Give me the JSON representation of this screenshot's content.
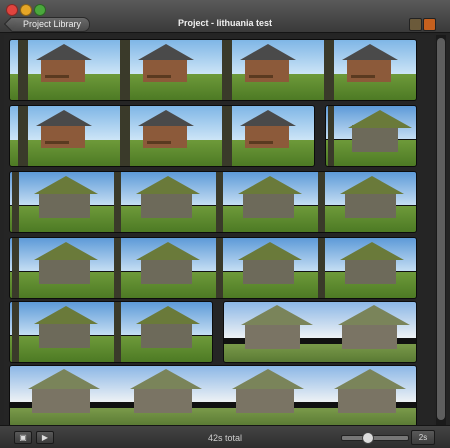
{
  "window": {
    "title": "Project - lithuania test",
    "back_button_label": "Project Library"
  },
  "colors": {
    "titlebar": "#474747",
    "background": "#242424",
    "accent_orange": "#c5601e"
  },
  "toolbar": {
    "right_icons": [
      "theme-icon",
      "music-icon"
    ]
  },
  "timeline": {
    "clips": [
      {
        "row": 1,
        "frames": 4,
        "scene": "swing-yard",
        "selected": false
      },
      {
        "row": 2,
        "frames": 3,
        "scene": "swing-yard",
        "selected": false
      },
      {
        "row": 2,
        "frames": 1,
        "scene": "house",
        "selected": false
      },
      {
        "row": 3,
        "frames": 4,
        "scene": "house",
        "selected": false
      },
      {
        "row": 4,
        "frames": 4,
        "scene": "house",
        "selected": false
      },
      {
        "row": 5,
        "frames": 2,
        "scene": "house",
        "selected": false
      },
      {
        "row": 5,
        "frames": 2,
        "scene": "house-clouds",
        "selected": false
      },
      {
        "row": 6,
        "frames": 4,
        "scene": "house-clouds",
        "selected": false
      }
    ]
  },
  "bottombar": {
    "total_label": "42s total",
    "duration_label": "2s",
    "play_icon": "play-fullscreen-icon",
    "play_from_start_icon": "play-icon",
    "zoom_level": 0.35
  }
}
